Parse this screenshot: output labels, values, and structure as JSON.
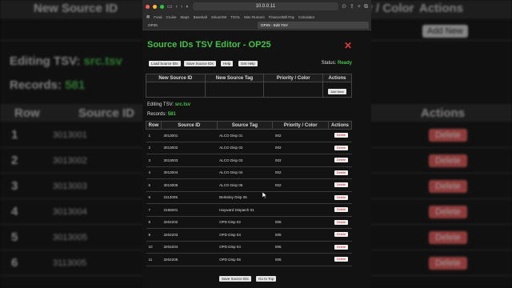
{
  "background": {
    "new_source_id_header": "New Source ID",
    "color_header": "r / Color",
    "actions_header": "Actions",
    "add_new_label": "Add New",
    "editing_label": "Editing TSV:",
    "editing_file": "src.tsv",
    "records_label": "Records:",
    "records_count": "581",
    "table_headers": [
      "Row",
      "Source ID",
      "Actions"
    ],
    "rows": [
      {
        "n": "1",
        "id": "3013001"
      },
      {
        "n": "2",
        "id": "3013002"
      },
      {
        "n": "3",
        "id": "3013003"
      },
      {
        "n": "4",
        "id": "3013004"
      },
      {
        "n": "5",
        "id": "3013005"
      },
      {
        "n": "6",
        "id": "3113005"
      }
    ],
    "delete_label": "Delete"
  },
  "browser": {
    "url": "10.0.0.11",
    "bookmarks": [
      "Food",
      "Cruise",
      "Maps",
      "Baseball",
      "Sirius/XM",
      "TOOL",
      "Mac Rumors",
      "Finance/Bill Pay",
      "Calculator"
    ],
    "tabs": [
      "OP25",
      "OP25 - Edit TSV"
    ]
  },
  "editor": {
    "title": "Source IDs TSV Editor - OP25",
    "close_symbol": "✕",
    "toolbar": {
      "load_label": "Load Source IDs",
      "save_label": "Save Source IDs",
      "help_label": "Help",
      "get_help_label": "Get Help"
    },
    "status_label": "Status:",
    "status_value": "Ready",
    "new_entry": {
      "headers": [
        "New Source ID",
        "New Source Tag",
        "Priority / Color",
        "Actions"
      ],
      "add_label": "Add New"
    },
    "editing_label": "Editing TSV:",
    "editing_file": "src.tsv",
    "records_label": "Records:",
    "records_count": "581",
    "table": {
      "headers": [
        "Row",
        "Source ID",
        "Source Tag",
        "Priority / Color",
        "Actions"
      ],
      "delete_label": "Delete",
      "rows": [
        {
          "row": "1",
          "id": "3013001",
          "tag": "ALCO Disp 01",
          "prio": "002"
        },
        {
          "row": "2",
          "id": "3013002",
          "tag": "ALCO Disp 02",
          "prio": "002"
        },
        {
          "row": "3",
          "id": "3013003",
          "tag": "ALCO Disp 03",
          "prio": "002"
        },
        {
          "row": "4",
          "id": "3013004",
          "tag": "ALCO Disp 04",
          "prio": "002"
        },
        {
          "row": "5",
          "id": "3013005",
          "tag": "ALCO Disp 05",
          "prio": "002"
        },
        {
          "row": "6",
          "id": "3113005",
          "tag": "Berkeley Disp 05",
          "prio": ""
        },
        {
          "row": "7",
          "id": "3165001",
          "tag": "Hayward Dispatch 01",
          "prio": ""
        },
        {
          "row": "8",
          "id": "3204202",
          "tag": "OPD Disp 02",
          "prio": "005"
        },
        {
          "row": "9",
          "id": "3204203",
          "tag": "OPD Disp 03",
          "prio": "005"
        },
        {
          "row": "10",
          "id": "3204204",
          "tag": "OPD Disp 04",
          "prio": "005"
        },
        {
          "row": "11",
          "id": "3204205",
          "tag": "OPD Disp 05",
          "prio": "005"
        }
      ]
    },
    "bottom": {
      "save_label": "Save Source IDs",
      "top_label": "Go to Top"
    }
  }
}
